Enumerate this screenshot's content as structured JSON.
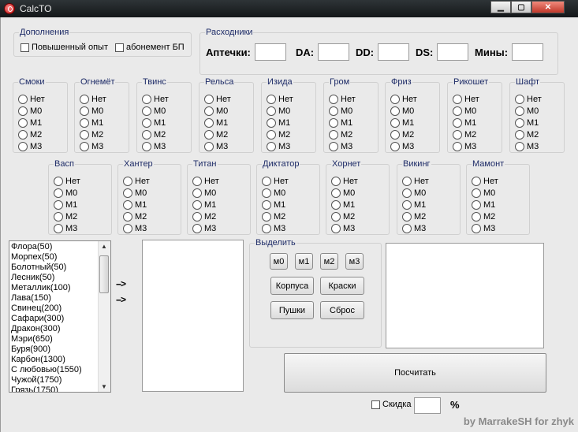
{
  "window": {
    "title": "CalcTO"
  },
  "addons": {
    "title": "Дополнения",
    "items": [
      "Повышенный опыт",
      "абонемент БП"
    ]
  },
  "consumables": {
    "title": "Расходники",
    "items": [
      {
        "label": "Аптечки:",
        "value": ""
      },
      {
        "label": "DA:",
        "value": ""
      },
      {
        "label": "DD:",
        "value": ""
      },
      {
        "label": "DS:",
        "value": ""
      },
      {
        "label": "Мины:",
        "value": ""
      }
    ]
  },
  "radio_options": [
    "Нет",
    "M0",
    "M1",
    "M2",
    "M3"
  ],
  "weapon_groups_row1": [
    {
      "title": "Смоки"
    },
    {
      "title": "Огнемёт"
    },
    {
      "title": "Твинс"
    },
    {
      "title": "Рельса"
    },
    {
      "title": "Изида"
    },
    {
      "title": "Гром"
    },
    {
      "title": "Фриз"
    },
    {
      "title": "Рикошет"
    },
    {
      "title": "Шафт"
    }
  ],
  "hull_groups_row2": [
    {
      "title": "Васп"
    },
    {
      "title": "Хантер"
    },
    {
      "title": "Титан"
    },
    {
      "title": "Диктатор"
    },
    {
      "title": "Хорнет"
    },
    {
      "title": "Викинг"
    },
    {
      "title": "Мамонт"
    }
  ],
  "paint_list": [
    "Флора(50)",
    "Морпех(50)",
    "Болотный(50)",
    "Лесник(50)",
    "Металлик(100)",
    "Лава(150)",
    "Свинец(200)",
    "Сафари(300)",
    "Дракон(300)",
    "Мэри(650)",
    "Буря(900)",
    "Карбон(1300)",
    "С любовью(1550)",
    "Чужой(1750)",
    "Грязь(1750)"
  ],
  "arrows": [
    "-->",
    "-->"
  ],
  "select": {
    "title": "Выделить",
    "m_buttons": [
      "м0",
      "м1",
      "м2",
      "м3"
    ],
    "hulls": "Корпуса",
    "paints": "Краски",
    "guns": "Пушки",
    "reset": "Сброс"
  },
  "calculate": "Посчитать",
  "discount": {
    "label": "Скидка",
    "value": "",
    "unit": "%"
  },
  "credit": "by MarrakeSH for zhyk"
}
